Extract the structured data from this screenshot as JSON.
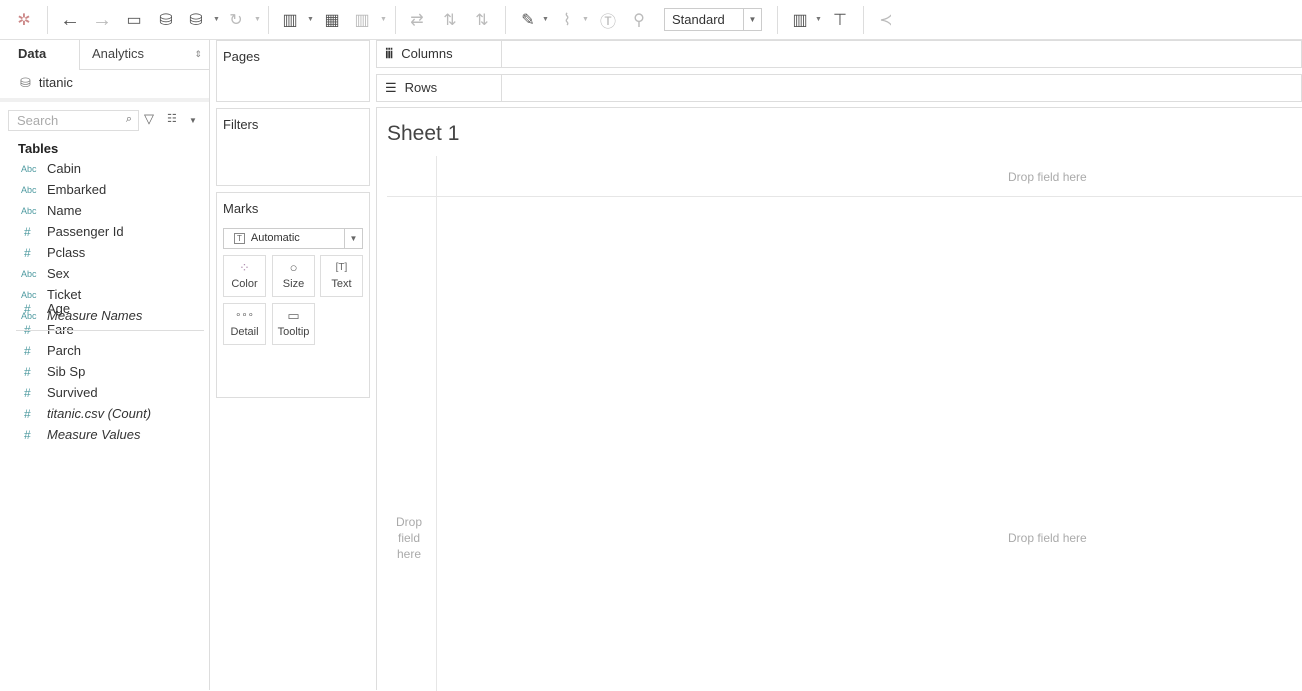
{
  "toolbar": {
    "mark_type": "Standard"
  },
  "left": {
    "tabs": [
      "Data",
      "Analytics"
    ],
    "datasource": "titanic",
    "search_placeholder": "Search",
    "tables_heading": "Tables",
    "fields": [
      {
        "type": "Abc",
        "name": "Cabin"
      },
      {
        "type": "Abc",
        "name": "Embarked"
      },
      {
        "type": "Abc",
        "name": "Name"
      },
      {
        "type": "#",
        "name": "Passenger Id"
      },
      {
        "type": "#",
        "name": "Pclass"
      },
      {
        "type": "Abc",
        "name": "Sex"
      },
      {
        "type": "Abc",
        "name": "Ticket"
      },
      {
        "type": "Abc",
        "name": "Measure Names"
      },
      {
        "type": "#",
        "name": "Age"
      },
      {
        "type": "#",
        "name": "Fare"
      },
      {
        "type": "#",
        "name": "Parch"
      },
      {
        "type": "#",
        "name": "Sib Sp"
      },
      {
        "type": "#",
        "name": "Survived"
      },
      {
        "type": "#",
        "name": "titanic.csv (Count)"
      },
      {
        "type": "#",
        "name": "Measure Values"
      }
    ]
  },
  "cards": {
    "pages": "Pages",
    "filters": "Filters",
    "marks": "Marks",
    "mark_select": "Automatic",
    "buttons": [
      "Color",
      "Size",
      "Text",
      "Detail",
      "Tooltip"
    ]
  },
  "shelves": {
    "columns": "Columns",
    "rows": "Rows"
  },
  "view": {
    "title": "Sheet 1",
    "drop_top": "Drop field here",
    "drop_left": "Drop field here",
    "drop_center": "Drop field here"
  }
}
